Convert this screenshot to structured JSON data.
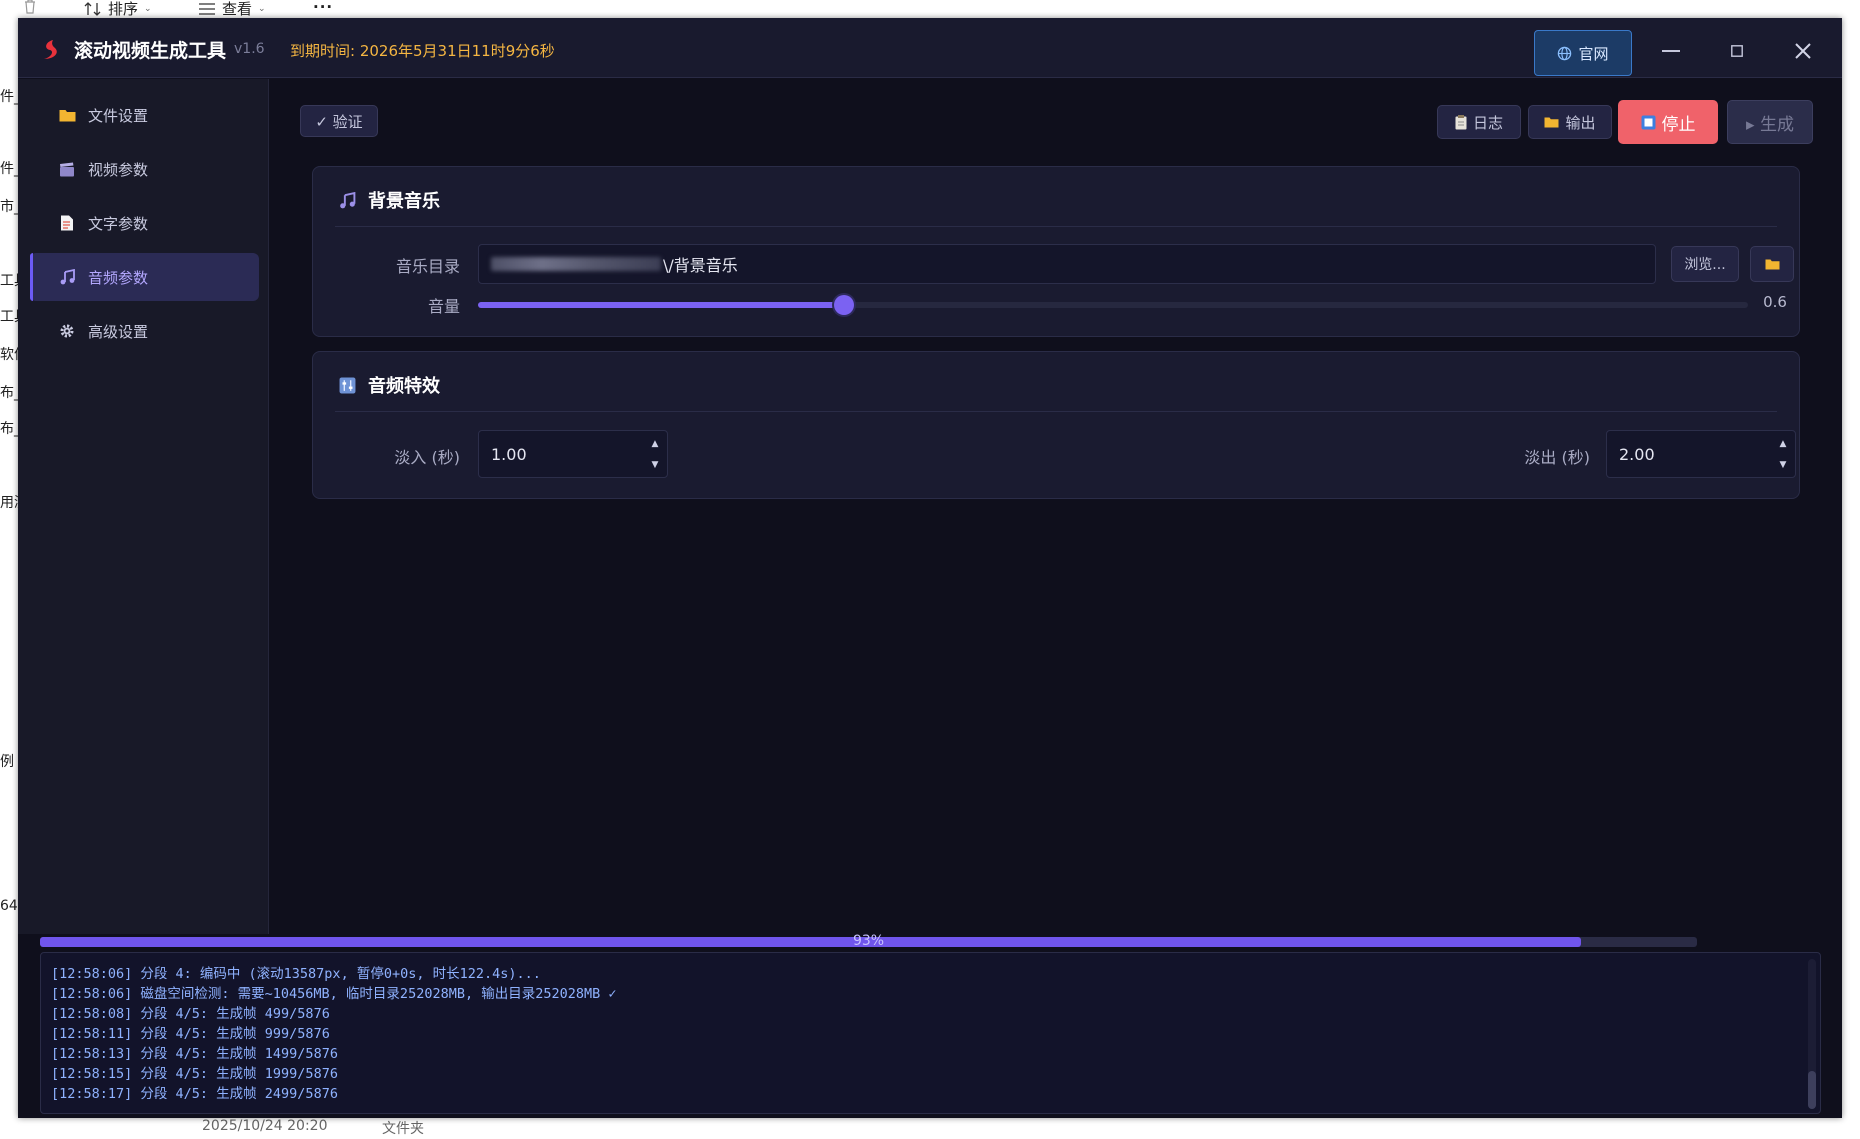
{
  "background": {
    "toolbar": {
      "sort_label": "排序",
      "view_label": "查看",
      "more_label": "···"
    },
    "left_fragments": [
      "件_",
      "件_",
      "市_",
      "工具",
      "工具",
      "软件",
      "布_",
      "布_",
      "用测",
      "例",
      "64"
    ],
    "bottom_date": "2025/10/24 20:20",
    "bottom_type": "文件夹"
  },
  "app": {
    "title": "滚动视频生成工具",
    "version": "v1.6",
    "expire_text": "到期时间: 2026年5月31日11时9分6秒",
    "site_button": "官网"
  },
  "sidebar": {
    "items": [
      {
        "label": "文件设置",
        "icon": "folder-icon"
      },
      {
        "label": "视频参数",
        "icon": "clapper-icon"
      },
      {
        "label": "文字参数",
        "icon": "document-icon"
      },
      {
        "label": "音频参数",
        "icon": "music-note-icon",
        "active": true
      },
      {
        "label": "高级设置",
        "icon": "gear-icon"
      }
    ]
  },
  "toolbar": {
    "verify": "✓ 验证",
    "log": "日志",
    "output": "输出",
    "stop": "停止",
    "generate": "▸ 生成"
  },
  "bg_music": {
    "title": "背景音乐",
    "dir_label": "音乐目录",
    "dir_value_suffix": "\\/背景音乐",
    "browse": "浏览...",
    "volume_label": "音量",
    "volume_value": "0.6",
    "volume_fraction": 0.288
  },
  "audio_fx": {
    "title": "音频特效",
    "fade_in_label": "淡入 (秒)",
    "fade_in_value": "1.00",
    "fade_out_label": "淡出 (秒)",
    "fade_out_value": "2.00"
  },
  "progress": {
    "percent": 93,
    "text": "93%"
  },
  "log": {
    "lines": [
      "[12:58:06] 分段 4: 编码中 (滚动13587px, 暂停0+0s, 时长122.4s)...",
      "[12:58:06] 磁盘空间检测: 需要~10456MB, 临时目录252028MB, 输出目录252028MB ✓",
      "[12:58:08] 分段 4/5: 生成帧 499/5876",
      "[12:58:11] 分段 4/5: 生成帧 999/5876",
      "[12:58:13] 分段 4/5: 生成帧 1499/5876",
      "[12:58:15] 分段 4/5: 生成帧 1999/5876",
      "[12:58:17] 分段 4/5: 生成帧 2499/5876"
    ]
  },
  "colors": {
    "accent": "#7b62f2",
    "stop": "#f0626a",
    "expire": "#f5b642",
    "log_text": "#8fb2ff"
  }
}
